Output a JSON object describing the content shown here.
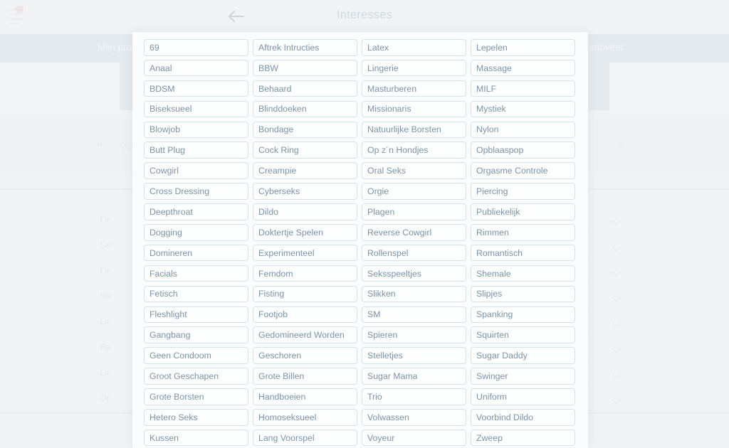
{
  "header": {
    "title": "Interesses",
    "menu_icon": "hamburger-icon",
    "notification_icon": "notification-dot",
    "back_icon": "back-arrow-icon"
  },
  "background": {
    "profile_band_left": "Mijn profiel",
    "profile_band_right": "Promoveer",
    "quote_open": "“",
    "quote_close": "”",
    "quote_text": "Vo",
    "rows": [
      {
        "label": "Ge",
        "chevron": "chevron-down-icon"
      },
      {
        "label": "Ler",
        "chevron": "chevron-down-icon"
      },
      {
        "label": "Ge",
        "chevron": "chevron-down-icon"
      },
      {
        "label": "Kle",
        "chevron": "chevron-down-icon"
      },
      {
        "label": "Lic",
        "chevron": "chevron-down-icon"
      },
      {
        "label": "Ha",
        "chevron": "chevron-down-icon"
      },
      {
        "label": "Lic",
        "chevron": "chevron-down-icon"
      },
      {
        "label": "Op",
        "chevron": "chevron-down-icon"
      }
    ]
  },
  "modal": {
    "name": "interests-picker",
    "columns": [
      [
        "69",
        "Anaal",
        "BDSM",
        "Biseksueel",
        "Blowjob",
        "Butt Plug",
        "Cowgirl",
        "Cross Dressing",
        "Deepthroat",
        "Dogging",
        "Domineren",
        "Facials",
        "Fetisch",
        "Fleshlight",
        "Gangbang",
        "Geen Condoom",
        "Groot Geschapen",
        "Grote Borsten",
        "Hetero Seks",
        "Kussen"
      ],
      [
        "Aftrek Intructies",
        "BBW",
        "Behaard",
        "Blinddoeken",
        "Bondage",
        "Cock Ring",
        "Creampie",
        "Cyberseks",
        "Dildo",
        "Doktertje Spelen",
        "Experimenteel",
        "Femdom",
        "Fisting",
        "Footjob",
        "Gedomineerd Worden",
        "Geschoren",
        "Grote Billen",
        "Handboeien",
        "Homoseksueel",
        "Lang Voorspel"
      ],
      [
        "Latex",
        "Lingerie",
        "Masturberen",
        "Missionaris",
        "Natuurlijke Borsten",
        "Op z´n Hondjes",
        "Oral Seks",
        "Orgie",
        "Plagen",
        "Reverse Cowgirl",
        "Rollenspel",
        "Seksspeeltjes",
        "Slikken",
        "SM",
        "Spieren",
        "Stelletjes",
        "Sugar Mama",
        "Trio",
        "Volwassen",
        "Voyeur"
      ],
      [
        "Lepelen",
        "Massage",
        "MILF",
        "Mystiek",
        "Nylon",
        "Opblaaspop",
        "Orgasme Controle",
        "Piercing",
        "Publiekelijk",
        "Rimmen",
        "Romantisch",
        "Shemale",
        "Slipjes",
        "Spanking",
        "Squirten",
        "Sugar Daddy",
        "Swinger",
        "Uniform",
        "Voorbind Dildo",
        "Zweep"
      ]
    ]
  },
  "colors": {
    "chip_border": "#d7e2eb",
    "chip_text": "#7c93a8",
    "band": "#c2d1da",
    "accent_line": "#cdd9e3",
    "notification": "#e3a8a1"
  }
}
